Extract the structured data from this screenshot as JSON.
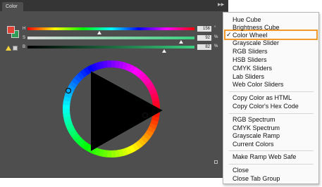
{
  "panel": {
    "tab_label": "Color",
    "collapse_icon": "collapse-icon",
    "foreground_color": "#e34234",
    "background_color": "#2f9e57",
    "sliders": [
      {
        "label": "H",
        "value": "156",
        "unit": "°",
        "fraction": 0.43
      },
      {
        "label": "S",
        "value": "92",
        "unit": "%",
        "fraction": 0.92
      },
      {
        "label": "B",
        "value": "82",
        "unit": "%",
        "fraction": 0.82
      }
    ],
    "gamut_warning_icon": "warning-icon",
    "web_safe_icon": "cube-icon"
  },
  "menu": {
    "items": [
      {
        "label": "Hue Cube"
      },
      {
        "label": "Brightness Cube"
      },
      {
        "label": "Color Wheel",
        "checked": true
      },
      {
        "label": "Grayscale Slider"
      },
      {
        "label": "RGB Sliders"
      },
      {
        "label": "HSB Sliders"
      },
      {
        "label": "CMYK Sliders"
      },
      {
        "label": "Lab Sliders"
      },
      {
        "label": "Web Color Sliders"
      },
      {
        "label": "Copy Color as HTML"
      },
      {
        "label": "Copy Color's Hex Code"
      },
      {
        "label": "RGB Spectrum"
      },
      {
        "label": "CMYK Spectrum"
      },
      {
        "label": "Grayscale Ramp"
      },
      {
        "label": "Current Colors"
      },
      {
        "label": "Make Ramp Web Safe"
      },
      {
        "label": "Close"
      },
      {
        "label": "Close Tab Group"
      }
    ],
    "check_mark": "✓",
    "highlight_color": "#f19a2a"
  }
}
